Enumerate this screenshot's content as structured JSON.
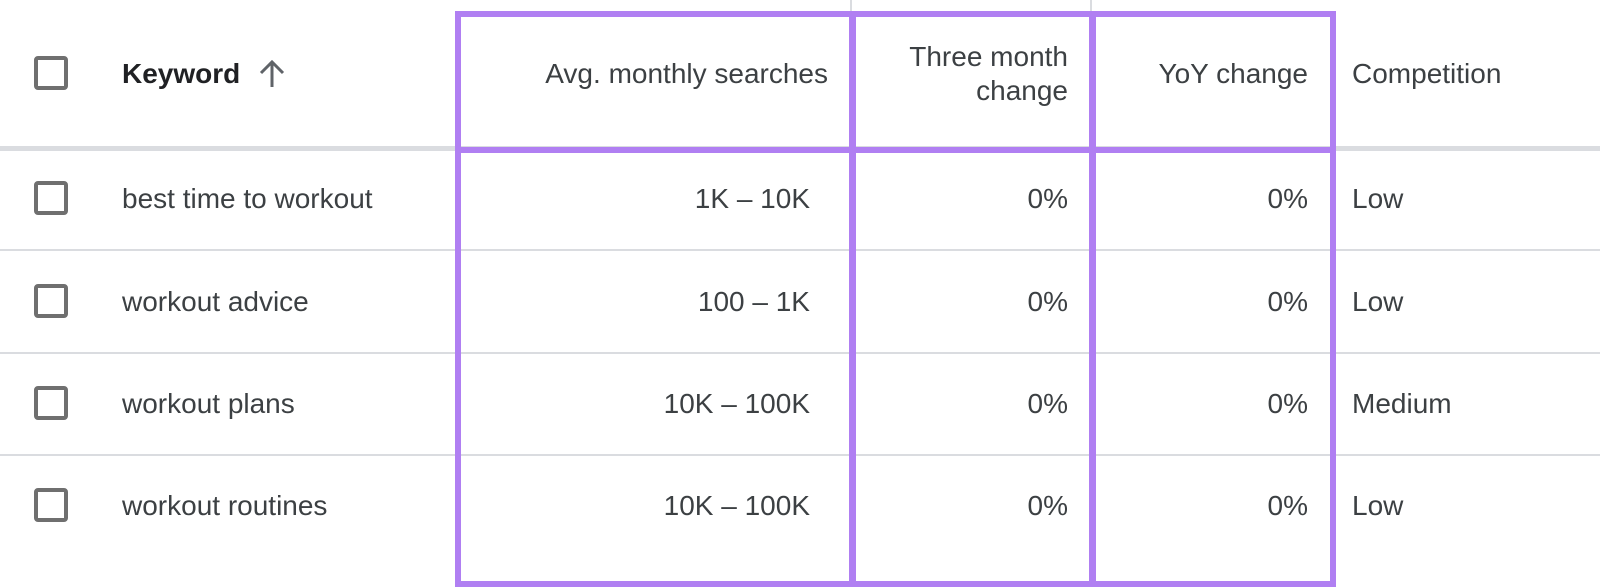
{
  "table": {
    "columns": {
      "keyword": "Keyword",
      "keyword_sort": "ascending",
      "avg_monthly_searches": "Avg. monthly searches",
      "three_month_change_line1": "Three month",
      "three_month_change_line2": "change",
      "yoy_change": "YoY change",
      "competition": "Competition"
    },
    "rows": [
      {
        "keyword": "best time to workout",
        "avg": "1K – 10K",
        "three_month": "0%",
        "yoy": "0%",
        "competition": "Low"
      },
      {
        "keyword": "workout advice",
        "avg": "100 – 1K",
        "three_month": "0%",
        "yoy": "0%",
        "competition": "Low"
      },
      {
        "keyword": "workout plans",
        "avg": "10K – 100K",
        "three_month": "0%",
        "yoy": "0%",
        "competition": "Medium"
      },
      {
        "keyword": "workout routines",
        "avg": "10K – 100K",
        "three_month": "0%",
        "yoy": "0%",
        "competition": "Low"
      }
    ]
  },
  "highlight_color": "#b07ff2"
}
